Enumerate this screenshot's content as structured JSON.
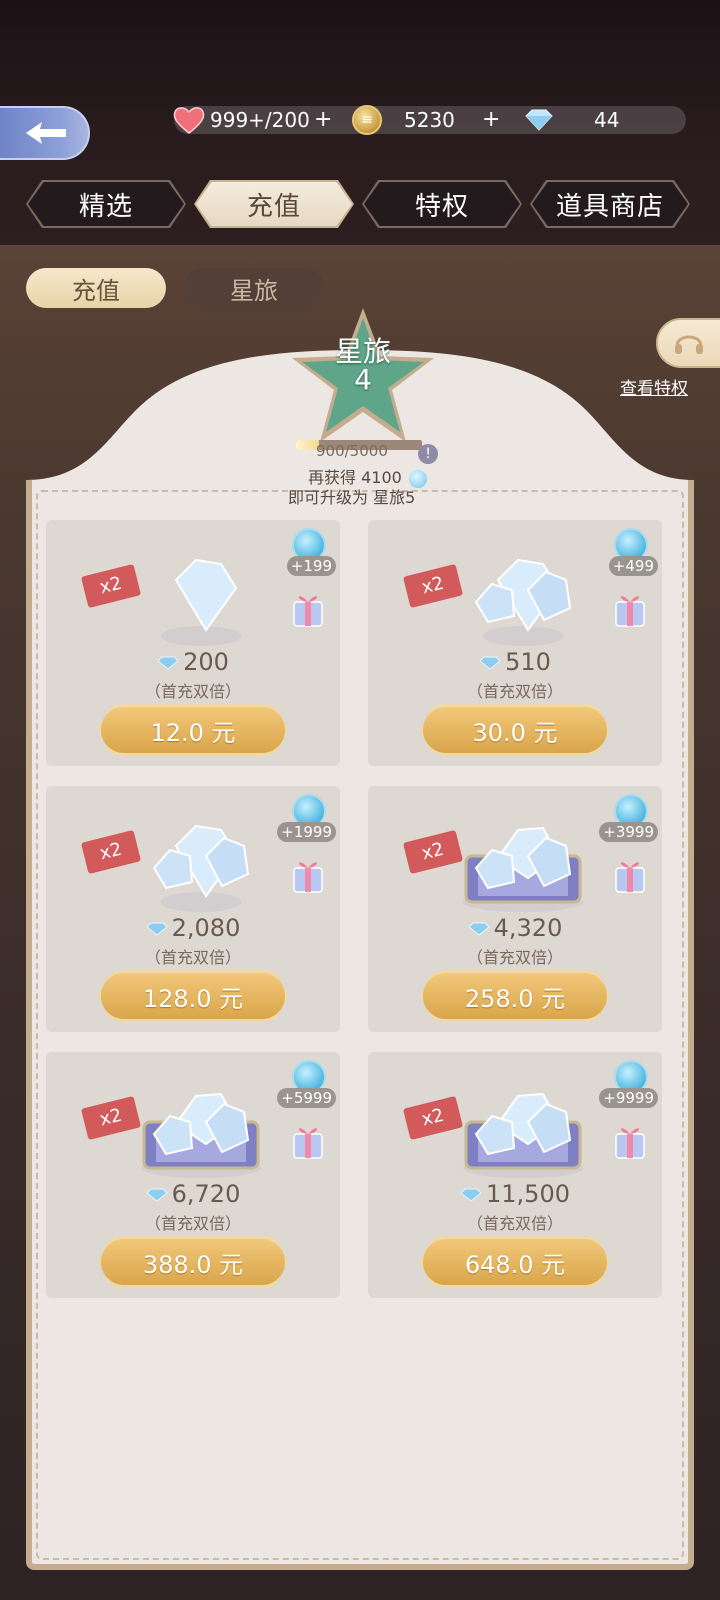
{
  "header": {
    "back_label": "back",
    "resources": {
      "stamina": "999+/200",
      "stamina_plus": "+",
      "coins": "5230",
      "coins_plus": "+",
      "diamonds": "44"
    }
  },
  "tabs": [
    {
      "label": "精选",
      "active": false
    },
    {
      "label": "充值",
      "active": true
    },
    {
      "label": "特权",
      "active": false
    },
    {
      "label": "道具商店",
      "active": false
    }
  ],
  "subtabs": [
    {
      "label": "充值",
      "active": true
    },
    {
      "label": "星旅",
      "active": false
    }
  ],
  "perks": {
    "link_text": "查看特权"
  },
  "level": {
    "title": "星旅",
    "number": "4",
    "progress_text": "900/5000",
    "progress_fraction": 0.18,
    "info_icon": "!",
    "upgrade_line1": "再获得 4100",
    "upgrade_line2": "即可升级为 星旅5"
  },
  "colors": {
    "accent_gold": "#d9a54a",
    "x2_red": "#d25a5a",
    "panel_bg": "#ece7e2"
  },
  "packs": [
    {
      "amount": "200",
      "note": "（首充双倍）",
      "bonus": "+199",
      "price": "12.0 元",
      "badge": "x2",
      "art": "single-diamond-icon"
    },
    {
      "amount": "510",
      "note": "（首充双倍）",
      "bonus": "+499",
      "price": "30.0 元",
      "badge": "x2",
      "art": "three-diamonds-icon"
    },
    {
      "amount": "2,080",
      "note": "（首充双倍）",
      "bonus": "+1999",
      "price": "128.0 元",
      "badge": "x2",
      "art": "diamond-pile-icon"
    },
    {
      "amount": "4,320",
      "note": "（首充双倍）",
      "bonus": "+3999",
      "price": "258.0 元",
      "badge": "x2",
      "art": "diamond-chest-icon"
    },
    {
      "amount": "6,720",
      "note": "（首充双倍）",
      "bonus": "+5999",
      "price": "388.0 元",
      "badge": "x2",
      "art": "diamond-chest-large-icon"
    },
    {
      "amount": "11,500",
      "note": "（首充双倍）",
      "bonus": "+9999",
      "price": "648.0 元",
      "badge": "x2",
      "art": "diamond-chest-best-icon"
    }
  ]
}
